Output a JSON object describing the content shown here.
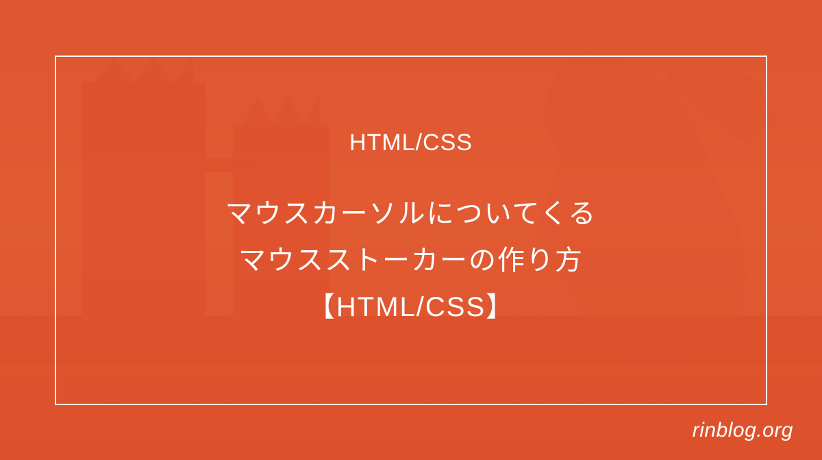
{
  "category": "HTML/CSS",
  "title_line1": "マウスカーソルについてくる",
  "title_line2": "マウスストーカーの作り方",
  "title_line3": "【HTML/CSS】",
  "site_name": "rinblog.org",
  "colors": {
    "overlay": "#e05730",
    "text": "#ffffff",
    "border": "#ffffff"
  }
}
